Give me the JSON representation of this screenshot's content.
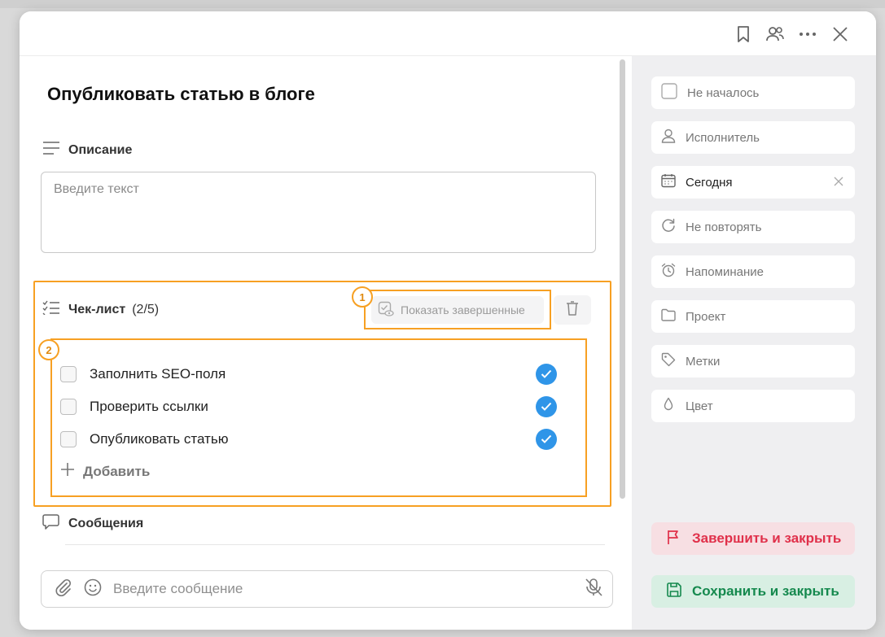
{
  "header": {
    "icons": [
      "bookmark-icon",
      "users-icon",
      "more-icon",
      "close-icon"
    ]
  },
  "task": {
    "title": "Опубликовать статью в блоге"
  },
  "description": {
    "heading": "Описание",
    "placeholder": "Введите текст"
  },
  "checklist": {
    "heading": "Чек-лист",
    "count": "(2/5)",
    "show_completed_label": "Показать завершенные",
    "items": [
      {
        "text": "Заполнить SEO-поля",
        "done": true
      },
      {
        "text": "Проверить ссылки",
        "done": true
      },
      {
        "text": "Опубликовать статью",
        "done": true
      }
    ],
    "add_label": "Добавить"
  },
  "annotations": {
    "badge_1": "1",
    "badge_2": "2",
    "highlight_color": "#f7a023"
  },
  "messages": {
    "heading": "Сообщения",
    "input_placeholder": "Введите сообщение"
  },
  "sidebar": {
    "items": [
      {
        "label": "Не началось",
        "icon": "status-checkbox-icon"
      },
      {
        "label": "Исполнитель",
        "icon": "person-icon"
      },
      {
        "label": "Сегодня",
        "icon": "calendar-icon"
      },
      {
        "label": "Не повторять",
        "icon": "repeat-icon"
      },
      {
        "label": "Напоминание",
        "icon": "alarm-icon"
      },
      {
        "label": "Проект",
        "icon": "folder-icon"
      },
      {
        "label": "Метки",
        "icon": "tag-icon"
      },
      {
        "label": "Цвет",
        "icon": "drop-icon"
      }
    ],
    "complete_label": "Завершить и закрыть",
    "save_label": "Сохранить и закрыть"
  },
  "colors": {
    "accent_blue": "#2f95e8",
    "complete_bg": "#f7dfe3",
    "complete_text": "#e0304a",
    "save_bg": "#d8efe3",
    "save_text": "#15894e"
  }
}
